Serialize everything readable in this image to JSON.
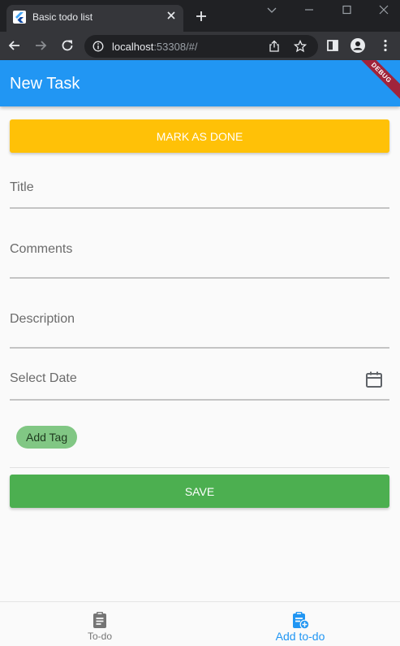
{
  "browser": {
    "tab_title": "Basic todo list",
    "url_host": "localhost",
    "url_rest": ":53308/#/"
  },
  "app": {
    "title": "New Task",
    "debug_banner": "DEBUG",
    "primary_color": "#2196f3"
  },
  "form": {
    "mark_done_label": "MARK AS DONE",
    "title_label": "Title",
    "title_value": "",
    "comments_label": "Comments",
    "comments_value": "",
    "description_label": "Description",
    "description_value": "",
    "date_label": "Select Date",
    "date_icon": "calendar-icon",
    "add_tag_label": "Add Tag",
    "save_label": "SAVE",
    "mark_done_color": "#ffc107",
    "save_color": "#4caf50"
  },
  "bottom_nav": {
    "items": [
      {
        "label": "To-do",
        "icon": "clipboard-icon",
        "active": false
      },
      {
        "label": "Add to-do",
        "icon": "add-task-icon",
        "active": true
      }
    ]
  }
}
